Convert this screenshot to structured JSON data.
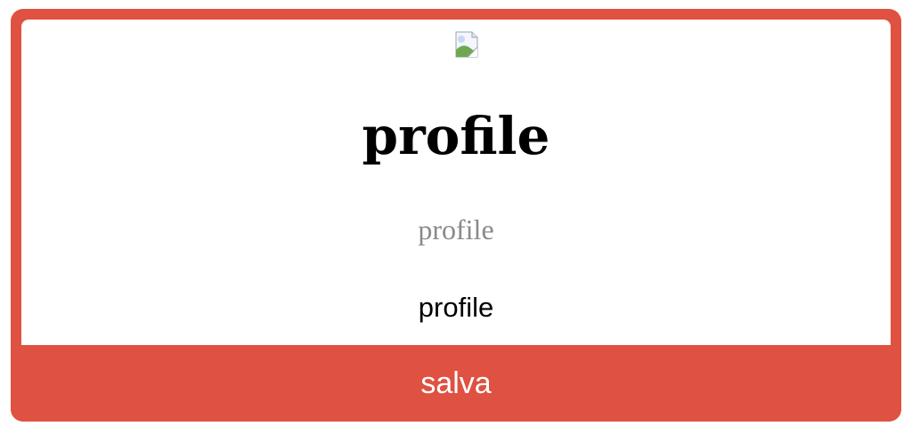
{
  "card": {
    "image_icon": "broken-image-icon",
    "title": "profile",
    "subtitle": "profile",
    "body_text": "profile",
    "save_label": "salva"
  },
  "colors": {
    "accent": "#df5141",
    "subtitle": "#8a8a8a",
    "background": "#ffffff"
  }
}
